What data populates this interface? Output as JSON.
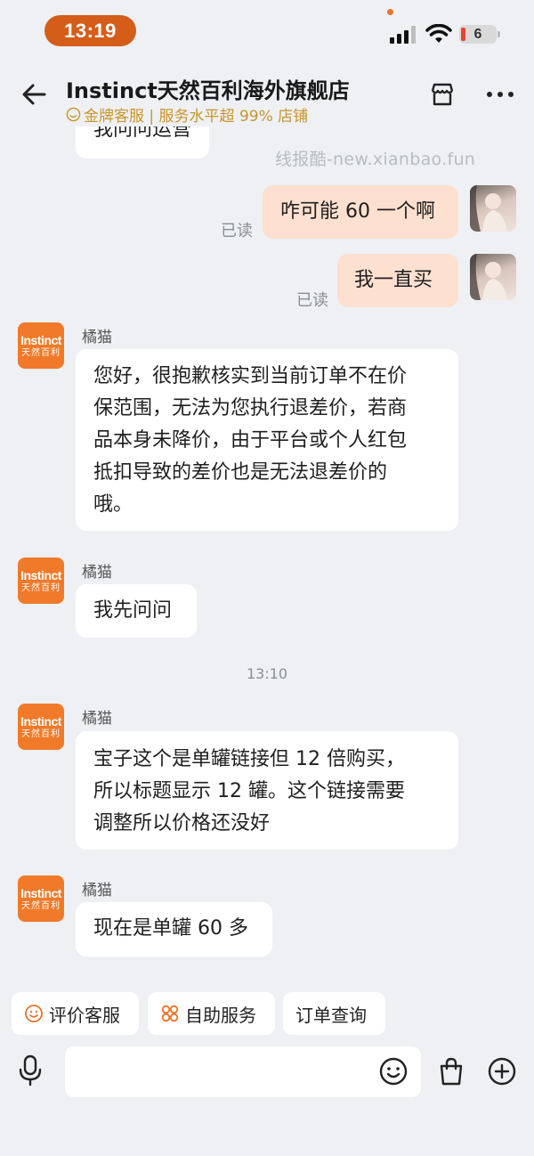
{
  "status_bar": {
    "time": "13:19",
    "battery": "6"
  },
  "header": {
    "title": "Instinct天然百利海外旗舰店",
    "subtitle": "金牌客服 | 服务水平超 99% 店铺"
  },
  "watermark": "线报酷-new.xianbao.fun",
  "messages": [
    {
      "from": "shop",
      "text": "我问问运营"
    },
    {
      "from": "user",
      "text": "咋可能 60 一个啊",
      "status": "已读"
    },
    {
      "from": "user",
      "text": "我一直买",
      "status": "已读"
    },
    {
      "from": "shop",
      "sender": "橘猫",
      "avatar_line1": "Instinct",
      "avatar_line2": "天然百利",
      "lines": [
        "您好，很抱歉核实到当前订单不在价",
        "保范围，无法为您执行退差价，若商",
        "品本身未降价，由于平台或个人红包",
        "抵扣导致的差价也是无法退差价的",
        "哦。"
      ]
    },
    {
      "from": "shop",
      "sender": "橘猫",
      "avatar_line1": "Instinct",
      "avatar_line2": "天然百利",
      "text": "我先问问"
    },
    {
      "timestamp": "13:10"
    },
    {
      "from": "shop",
      "sender": "橘猫",
      "avatar_line1": "Instinct",
      "avatar_line2": "天然百利",
      "lines": [
        "宝子这个是单罐链接但 12 倍购买，",
        "所以标题显示 12 罐。这个链接需要",
        "调整所以价格还没好"
      ]
    },
    {
      "from": "shop",
      "sender": "橘猫",
      "avatar_line1": "Instinct",
      "avatar_line2": "天然百利",
      "text": "现在是单罐 60 多"
    }
  ],
  "quick_actions": [
    {
      "label": "评价客服",
      "icon": "smile-icon"
    },
    {
      "label": "自助服务",
      "icon": "grid-dots-icon"
    },
    {
      "label": "订单查询",
      "icon": ""
    }
  ],
  "input": {
    "placeholder": ""
  },
  "colors": {
    "accent": "#d45d1a",
    "user_bubble": "#fde0d0",
    "brand": "#f07a2a",
    "gold": "#c8952a"
  }
}
